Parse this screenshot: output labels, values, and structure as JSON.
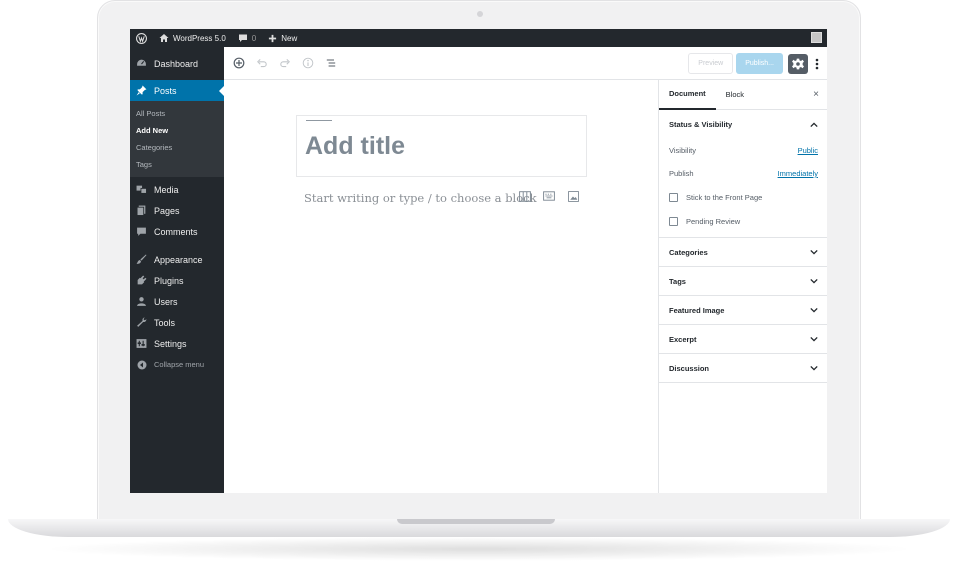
{
  "adminbar": {
    "site_name": "WordPress 5.0",
    "comments_count": "0",
    "new_label": "New"
  },
  "sidebar": {
    "items": [
      {
        "label": "Dashboard",
        "icon": "dashboard-icon"
      },
      {
        "label": "Posts",
        "icon": "pin-icon",
        "active": true
      },
      {
        "label": "Media",
        "icon": "media-icon"
      },
      {
        "label": "Pages",
        "icon": "pages-icon"
      },
      {
        "label": "Comments",
        "icon": "comment-icon"
      },
      {
        "label": "Appearance",
        "icon": "brush-icon"
      },
      {
        "label": "Plugins",
        "icon": "plugin-icon"
      },
      {
        "label": "Users",
        "icon": "user-icon"
      },
      {
        "label": "Tools",
        "icon": "wrench-icon"
      },
      {
        "label": "Settings",
        "icon": "settings-icon"
      }
    ],
    "submenu": [
      "All Posts",
      "Add New",
      "Categories",
      "Tags"
    ],
    "collapse_label": "Collapse menu"
  },
  "toolbar": {
    "preview_label": "Preview",
    "publish_label": "Publish..."
  },
  "editor": {
    "title_placeholder": "Add title",
    "body_placeholder": "Start writing or type / to choose a block"
  },
  "settings": {
    "tabs": [
      "Document",
      "Block"
    ],
    "close_symbol": "×",
    "status": {
      "heading": "Status & Visibility",
      "visibility_label": "Visibility",
      "visibility_value": "Public",
      "publish_label": "Publish",
      "publish_value": "Immediately",
      "sticky_label": "Stick to the Front Page",
      "pending_label": "Pending Review"
    },
    "panels": [
      "Categories",
      "Tags",
      "Featured Image",
      "Excerpt",
      "Discussion"
    ]
  },
  "colors": {
    "admin_dark": "#23282d",
    "accent_blue": "#0073aa",
    "publish_disabled": "#a9d6ee"
  }
}
